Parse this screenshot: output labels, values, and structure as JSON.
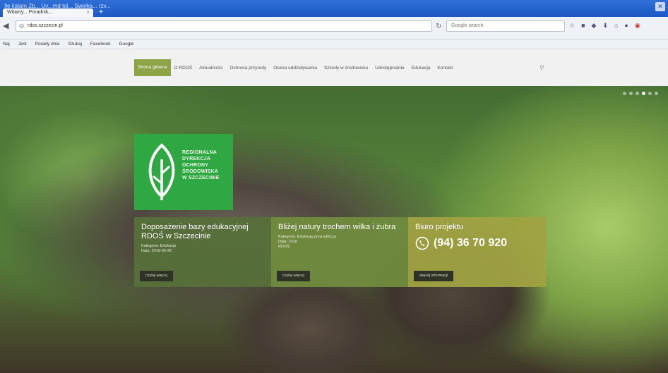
{
  "browser": {
    "window_title": "Ile kalam Zb... Uv...rnd tol... Swelka... rzv...",
    "tab_title": "Witamy... Poradnik...",
    "url": "rdos.szczecin.pl",
    "search_placeholder": "Google search",
    "bookmarks": [
      "Naj",
      "Jest",
      "Porady dnia",
      "Szukaj",
      "Facebook",
      "Google"
    ]
  },
  "site": {
    "nav": [
      "Strona główna",
      "O RDOŚ",
      "Aktualności",
      "Ochrona przyrody",
      "Ocena oddziaływania",
      "Szkody w środowisku",
      "Udostępnianie",
      "Edukacja",
      "Kontakt"
    ]
  },
  "logo": {
    "lines": [
      "REGIONALNA",
      "DYREKCJA",
      "OCHRONY",
      "ŚRODOWISKA",
      "W SZCZECINIE"
    ]
  },
  "cards": [
    {
      "title": "Doposażenie bazy edukacyjnej RDOŚ w Szczecinie",
      "meta_lines": [
        "Kategoria: Edukacja",
        "Data: 2016-09-28"
      ],
      "button": "czytaj więcej"
    },
    {
      "title": "Bliżej natury trochem wilka i żubra",
      "meta_lines": [
        "Kategoria: Edukacja przyrodnicza",
        "Data: 2016",
        "RDOŚ"
      ],
      "button": "czytaj więcej"
    },
    {
      "title": "Biuro projektu",
      "phone": "(94) 36 70 920",
      "button": "więcej informacji"
    }
  ],
  "colors": {
    "nav_active": "#8ea547",
    "logo_green": "#2fa843",
    "card1": "#56703a",
    "card2": "#708c3e",
    "card3": "#a0a242"
  }
}
